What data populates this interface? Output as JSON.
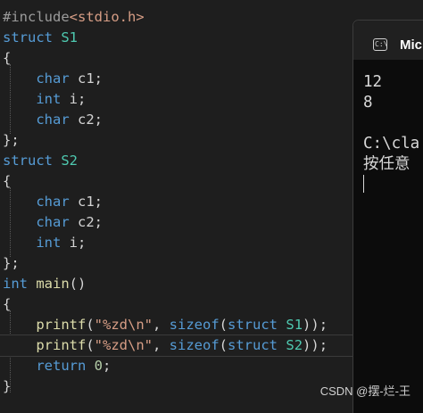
{
  "editor": {
    "lines": [
      {
        "parts": [
          {
            "t": "#include",
            "c": "pp"
          },
          {
            "t": "<stdio.h>",
            "c": "inc"
          }
        ]
      },
      {
        "parts": [
          {
            "t": "struct",
            "c": "kw"
          },
          {
            "t": " ",
            "c": "plain"
          },
          {
            "t": "S1",
            "c": "ty"
          }
        ]
      },
      {
        "parts": [
          {
            "t": "{",
            "c": "plain"
          }
        ]
      },
      {
        "parts": [
          {
            "t": "    ",
            "c": "plain"
          },
          {
            "t": "char",
            "c": "kw"
          },
          {
            "t": " c1;",
            "c": "plain"
          }
        ]
      },
      {
        "parts": [
          {
            "t": "    ",
            "c": "plain"
          },
          {
            "t": "int",
            "c": "kw"
          },
          {
            "t": " i;",
            "c": "plain"
          }
        ]
      },
      {
        "parts": [
          {
            "t": "    ",
            "c": "plain"
          },
          {
            "t": "char",
            "c": "kw"
          },
          {
            "t": " c2;",
            "c": "plain"
          }
        ]
      },
      {
        "parts": [
          {
            "t": "};",
            "c": "plain"
          }
        ]
      },
      {
        "parts": [
          {
            "t": "struct",
            "c": "kw"
          },
          {
            "t": " ",
            "c": "plain"
          },
          {
            "t": "S2",
            "c": "ty"
          }
        ]
      },
      {
        "parts": [
          {
            "t": "{",
            "c": "plain"
          }
        ]
      },
      {
        "parts": [
          {
            "t": "    ",
            "c": "plain"
          },
          {
            "t": "char",
            "c": "kw"
          },
          {
            "t": " c1;",
            "c": "plain"
          }
        ]
      },
      {
        "parts": [
          {
            "t": "    ",
            "c": "plain"
          },
          {
            "t": "char",
            "c": "kw"
          },
          {
            "t": " c2;",
            "c": "plain"
          }
        ]
      },
      {
        "parts": [
          {
            "t": "    ",
            "c": "plain"
          },
          {
            "t": "int",
            "c": "kw"
          },
          {
            "t": " i;",
            "c": "plain"
          }
        ]
      },
      {
        "parts": [
          {
            "t": "};",
            "c": "plain"
          }
        ]
      },
      {
        "parts": [
          {
            "t": "int",
            "c": "kw"
          },
          {
            "t": " ",
            "c": "plain"
          },
          {
            "t": "main",
            "c": "fn"
          },
          {
            "t": "()",
            "c": "plain"
          }
        ]
      },
      {
        "parts": [
          {
            "t": "{",
            "c": "plain"
          }
        ]
      },
      {
        "parts": [
          {
            "t": "    ",
            "c": "plain"
          },
          {
            "t": "printf",
            "c": "fn"
          },
          {
            "t": "(",
            "c": "plain"
          },
          {
            "t": "\"%zd\\n\"",
            "c": "str"
          },
          {
            "t": ", ",
            "c": "plain"
          },
          {
            "t": "sizeof",
            "c": "kw"
          },
          {
            "t": "(",
            "c": "plain"
          },
          {
            "t": "struct",
            "c": "kw"
          },
          {
            "t": " ",
            "c": "plain"
          },
          {
            "t": "S1",
            "c": "ty"
          },
          {
            "t": "));",
            "c": "plain"
          }
        ]
      },
      {
        "parts": [
          {
            "t": "    ",
            "c": "plain"
          },
          {
            "t": "printf",
            "c": "fn"
          },
          {
            "t": "(",
            "c": "plain"
          },
          {
            "t": "\"%zd\\n\"",
            "c": "str"
          },
          {
            "t": ", ",
            "c": "plain"
          },
          {
            "t": "sizeof",
            "c": "kw"
          },
          {
            "t": "(",
            "c": "plain"
          },
          {
            "t": "struct",
            "c": "kw"
          },
          {
            "t": " ",
            "c": "plain"
          },
          {
            "t": "S2",
            "c": "ty"
          },
          {
            "t": "));",
            "c": "plain"
          }
        ],
        "current": true
      },
      {
        "parts": [
          {
            "t": "    ",
            "c": "plain"
          },
          {
            "t": "return",
            "c": "kw"
          },
          {
            "t": " ",
            "c": "plain"
          },
          {
            "t": "0",
            "c": "num"
          },
          {
            "t": ";",
            "c": "plain"
          }
        ]
      },
      {
        "parts": [
          {
            "t": "}",
            "c": "plain"
          }
        ]
      }
    ]
  },
  "terminal": {
    "title": "Mic",
    "icon": "terminal-icon",
    "icon_glyph": "C:\\",
    "output_lines": [
      "12",
      "8",
      "",
      "C:\\cla",
      "按任意"
    ]
  },
  "watermark": "CSDN @摆-烂-王"
}
